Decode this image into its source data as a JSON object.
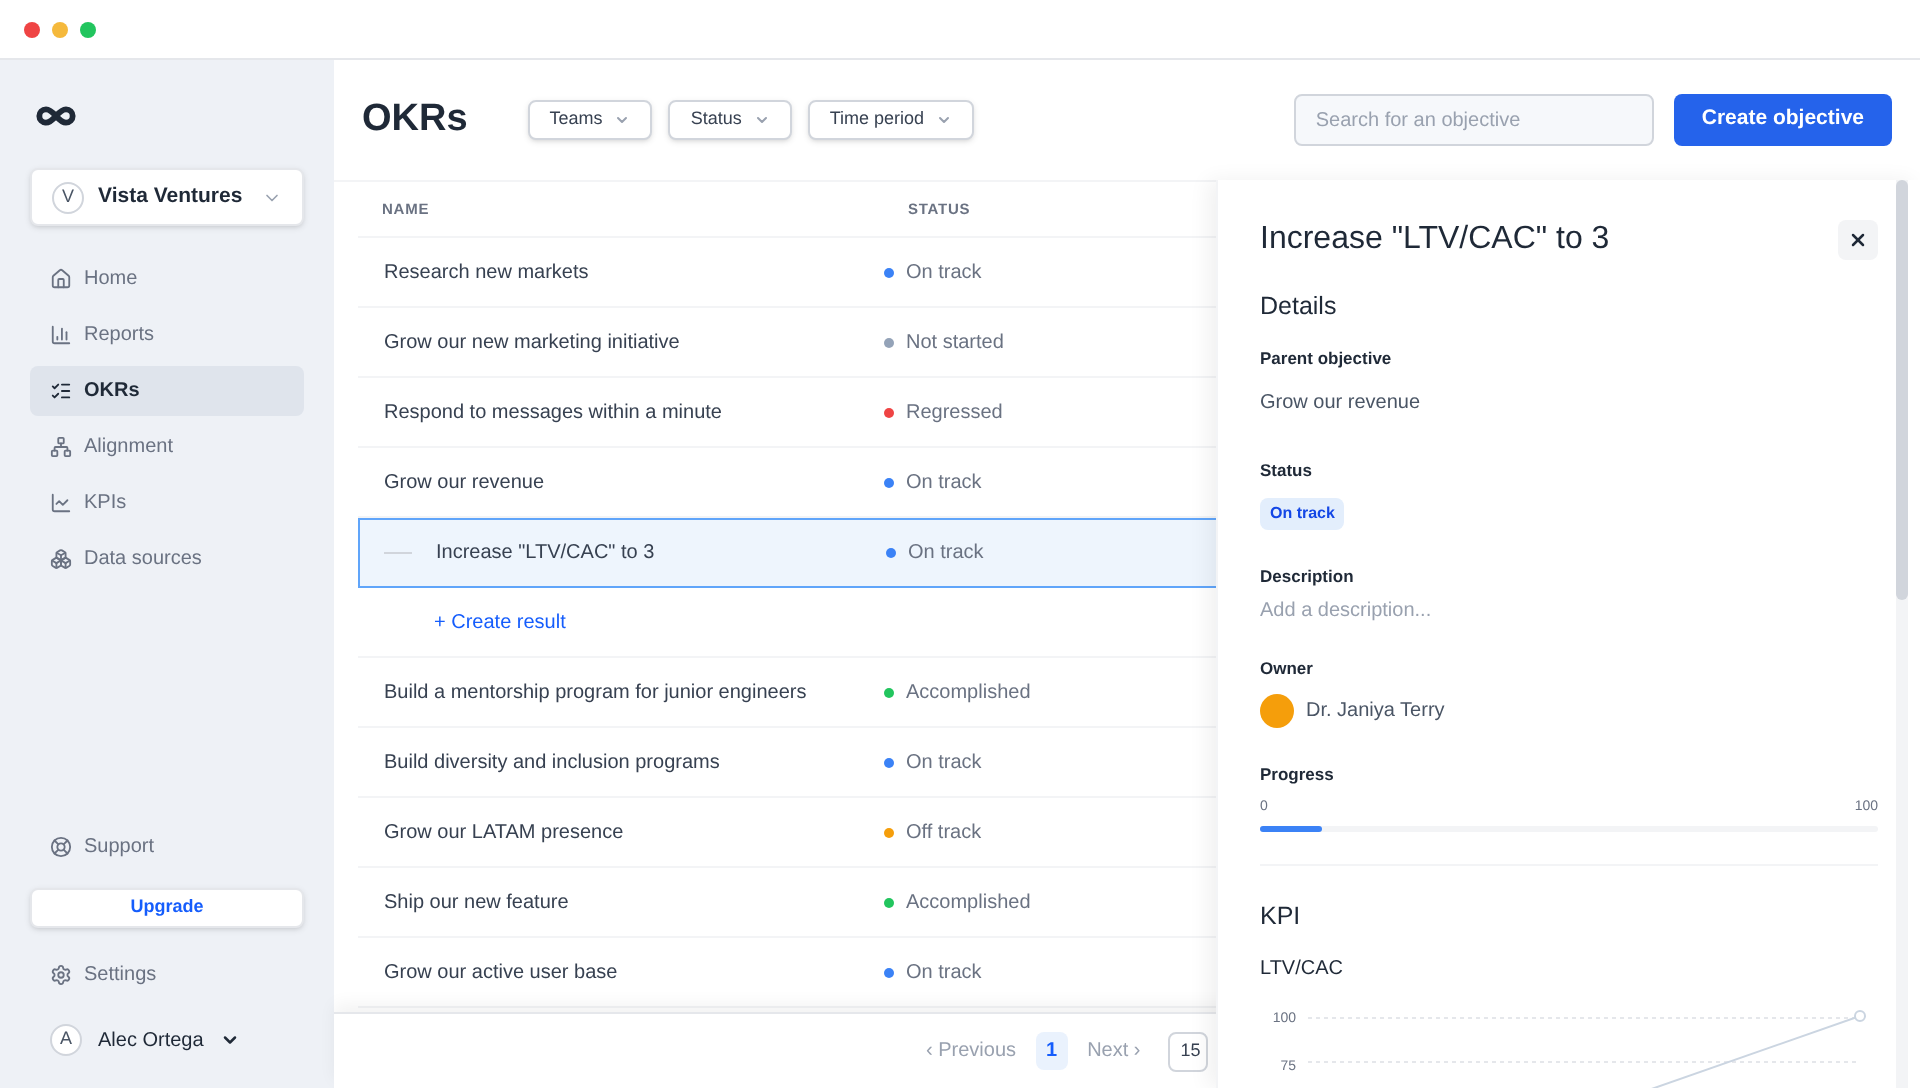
{
  "workspace": {
    "initial": "V",
    "name": "Vista Ventures"
  },
  "nav": [
    {
      "kind": "home",
      "label": "Home",
      "selected": false
    },
    {
      "kind": "reports",
      "label": "Reports",
      "selected": false
    },
    {
      "kind": "okrs",
      "label": "OKRs",
      "selected": true
    },
    {
      "kind": "alignment",
      "label": "Alignment",
      "selected": false
    },
    {
      "kind": "kpis",
      "label": "KPIs",
      "selected": false
    },
    {
      "kind": "data",
      "label": "Data sources",
      "selected": false
    }
  ],
  "support": "Support",
  "upgrade": "Upgrade",
  "settings": "Settings",
  "user": {
    "initial": "A",
    "name": "Alec Ortega"
  },
  "page_title": "OKRs",
  "filters": [
    "Teams",
    "Status",
    "Time period"
  ],
  "search": {
    "placeholder": "Search for an objective"
  },
  "create_button": "Create objective",
  "table": {
    "columns": [
      "NAME",
      "STATUS"
    ],
    "rows": [
      {
        "name": "Research new markets",
        "status": "On track",
        "color": "#3b82f6",
        "selected": false
      },
      {
        "name": "Grow our new marketing initiative",
        "status": "Not started",
        "color": "#94a3b8",
        "selected": false
      },
      {
        "name": "Respond to messages within a minute",
        "status": "Regressed",
        "color": "#ef4444",
        "selected": false
      },
      {
        "name": "Grow our revenue",
        "status": "On track",
        "color": "#3b82f6",
        "selected": false,
        "children": [
          {
            "kind": "result",
            "name": "Increase \"LTV/CAC\" to 3",
            "status": "On track",
            "color": "#3b82f6",
            "selected": true
          },
          {
            "kind": "action",
            "name": "+ Create result"
          }
        ]
      },
      {
        "name": "Build a mentorship program for junior engineers",
        "status": "Accomplished",
        "color": "#22c55e",
        "selected": false
      },
      {
        "name": "Build diversity and inclusion programs",
        "status": "On track",
        "color": "#3b82f6",
        "selected": false
      },
      {
        "name": "Grow our LATAM presence",
        "status": "Off track",
        "color": "#f59e0b",
        "selected": false
      },
      {
        "name": "Ship our new feature",
        "status": "Accomplished",
        "color": "#22c55e",
        "selected": false
      },
      {
        "name": "Grow our active user base",
        "status": "On track",
        "color": "#3b82f6",
        "selected": false
      }
    ]
  },
  "pagination": {
    "previous": "‹ Previous",
    "pages": [
      {
        "label": "1",
        "selected": true
      }
    ],
    "next": "Next ›",
    "page_size": "15"
  },
  "detail": {
    "title": "Increase \"LTV/CAC\" to 3",
    "section": "Details",
    "parent_label": "Parent objective",
    "parent": "Grow our revenue",
    "status_label": "Status",
    "status": "On track",
    "description_label": "Description",
    "description_placeholder": "Add a description...",
    "owner_label": "Owner",
    "owner": "Dr. Janiya Terry",
    "progress_label": "Progress",
    "progress_min": "0",
    "progress_max": "100",
    "level": 0.1,
    "kpi_heading": "KPI",
    "kpi_name": "LTV/CAC",
    "axis_labels": [
      "100",
      "75"
    ]
  }
}
